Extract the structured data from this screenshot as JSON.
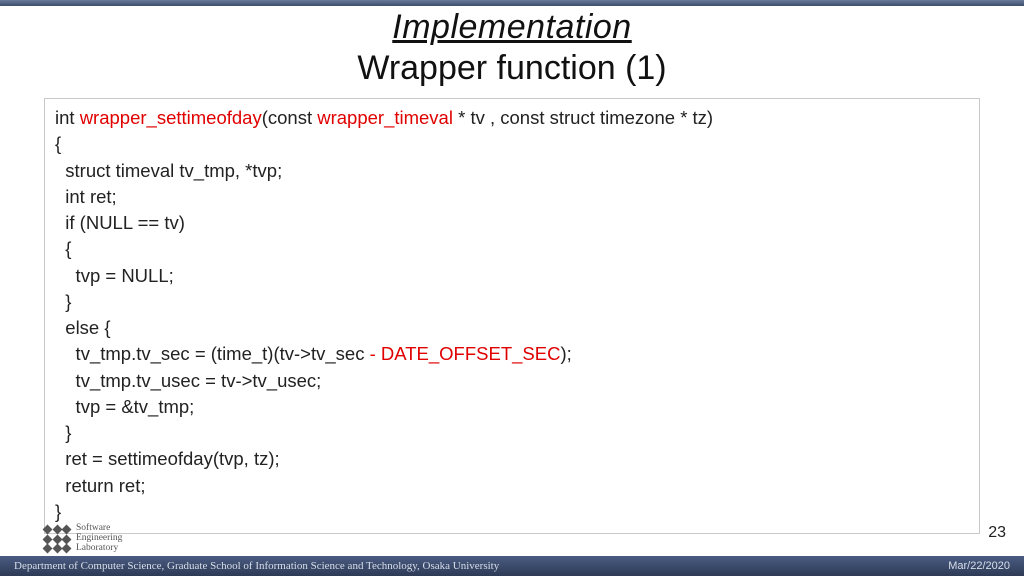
{
  "title": {
    "line1": "Implementation",
    "line2": "Wrapper function (1)"
  },
  "code": {
    "l1_a": "int ",
    "l1_b": "wrapper_settimeofday",
    "l1_c": "(const ",
    "l1_d": "wrapper_timeval",
    "l1_e": " * tv , const struct timezone * tz)",
    "l2": "{",
    "l3": "  struct timeval tv_tmp, *tvp;",
    "l4": "  int ret;",
    "l5": "  if (NULL == tv)",
    "l6": "  {",
    "l7": "    tvp = NULL;",
    "l8": "  }",
    "l9": "  else {",
    "l10_a": "    tv_tmp.tv_sec = (time_t)(tv->tv_sec ",
    "l10_b": "- DATE_OFFSET_SEC",
    "l10_c": ");",
    "l11": "    tv_tmp.tv_usec = tv->tv_usec;",
    "l12": "    tvp = &tv_tmp;",
    "l13": "  }",
    "l14": "  ret = settimeofday(tvp, tz);",
    "l15": "  return ret;",
    "l16": "}"
  },
  "logo": {
    "line1": "Software",
    "line2": "Engineering",
    "line3": "Laboratory"
  },
  "page_number": "23",
  "footer": {
    "left": "Department of Computer Science, Graduate School of Information Science and Technology, Osaka University",
    "right": "Mar/22/2020"
  }
}
